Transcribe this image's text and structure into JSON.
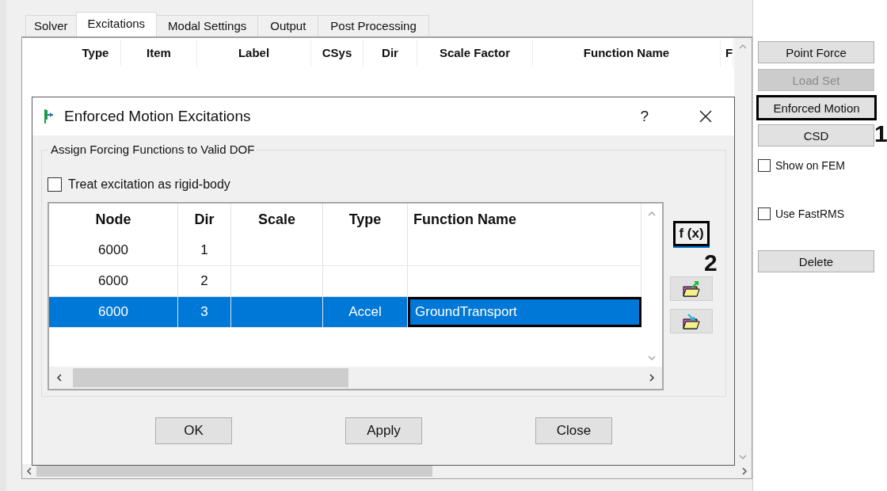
{
  "tabs": [
    {
      "label": "Solver",
      "selected": false
    },
    {
      "label": "Excitations",
      "selected": true
    },
    {
      "label": "Modal Settings",
      "selected": false
    },
    {
      "label": "Output",
      "selected": false
    },
    {
      "label": "Post Processing",
      "selected": false
    }
  ],
  "excitation_table": {
    "columns": [
      "Type",
      "Item",
      "Label",
      "CSys",
      "Dir",
      "Scale Factor",
      "Function Name",
      "F"
    ]
  },
  "side_buttons": [
    {
      "label": "Point Force",
      "disabled": false,
      "highlighted": false
    },
    {
      "label": "Load Set",
      "disabled": true,
      "highlighted": false
    },
    {
      "label": "Enforced Motion",
      "disabled": false,
      "highlighted": true
    },
    {
      "label": "CSD",
      "disabled": false,
      "highlighted": false
    }
  ],
  "side_annotation": "1",
  "side_checks": [
    {
      "label": "Show on FEM",
      "checked": false
    },
    {
      "label": "Use FastRMS",
      "checked": false
    }
  ],
  "delete_button": "Delete",
  "dialog": {
    "title": "Enforced Motion Excitations",
    "help": "?",
    "group_title": "Assign Forcing Functions to Valid DOF",
    "rigid_body": {
      "label": "Treat excitation as rigid-body",
      "checked": false
    },
    "columns": [
      "Node",
      "Dir",
      "Scale",
      "Type",
      "Function Name"
    ],
    "rows": [
      {
        "node": "6000",
        "dir": "1",
        "selected": false,
        "function_highlighted": false
      },
      {
        "node": "6000",
        "dir": "2",
        "selected": false,
        "function_highlighted": false
      },
      {
        "node": "6000",
        "dir": "3",
        "type": "Accel",
        "function": "GroundTransport",
        "selected": true,
        "function_highlighted": true
      }
    ],
    "tools": [
      {
        "kind": "function",
        "label": "f (x)",
        "highlighted": true
      },
      {
        "kind": "export"
      },
      {
        "kind": "import"
      }
    ],
    "tool_annotation": "2",
    "buttons": [
      "OK",
      "Apply",
      "Close"
    ]
  }
}
